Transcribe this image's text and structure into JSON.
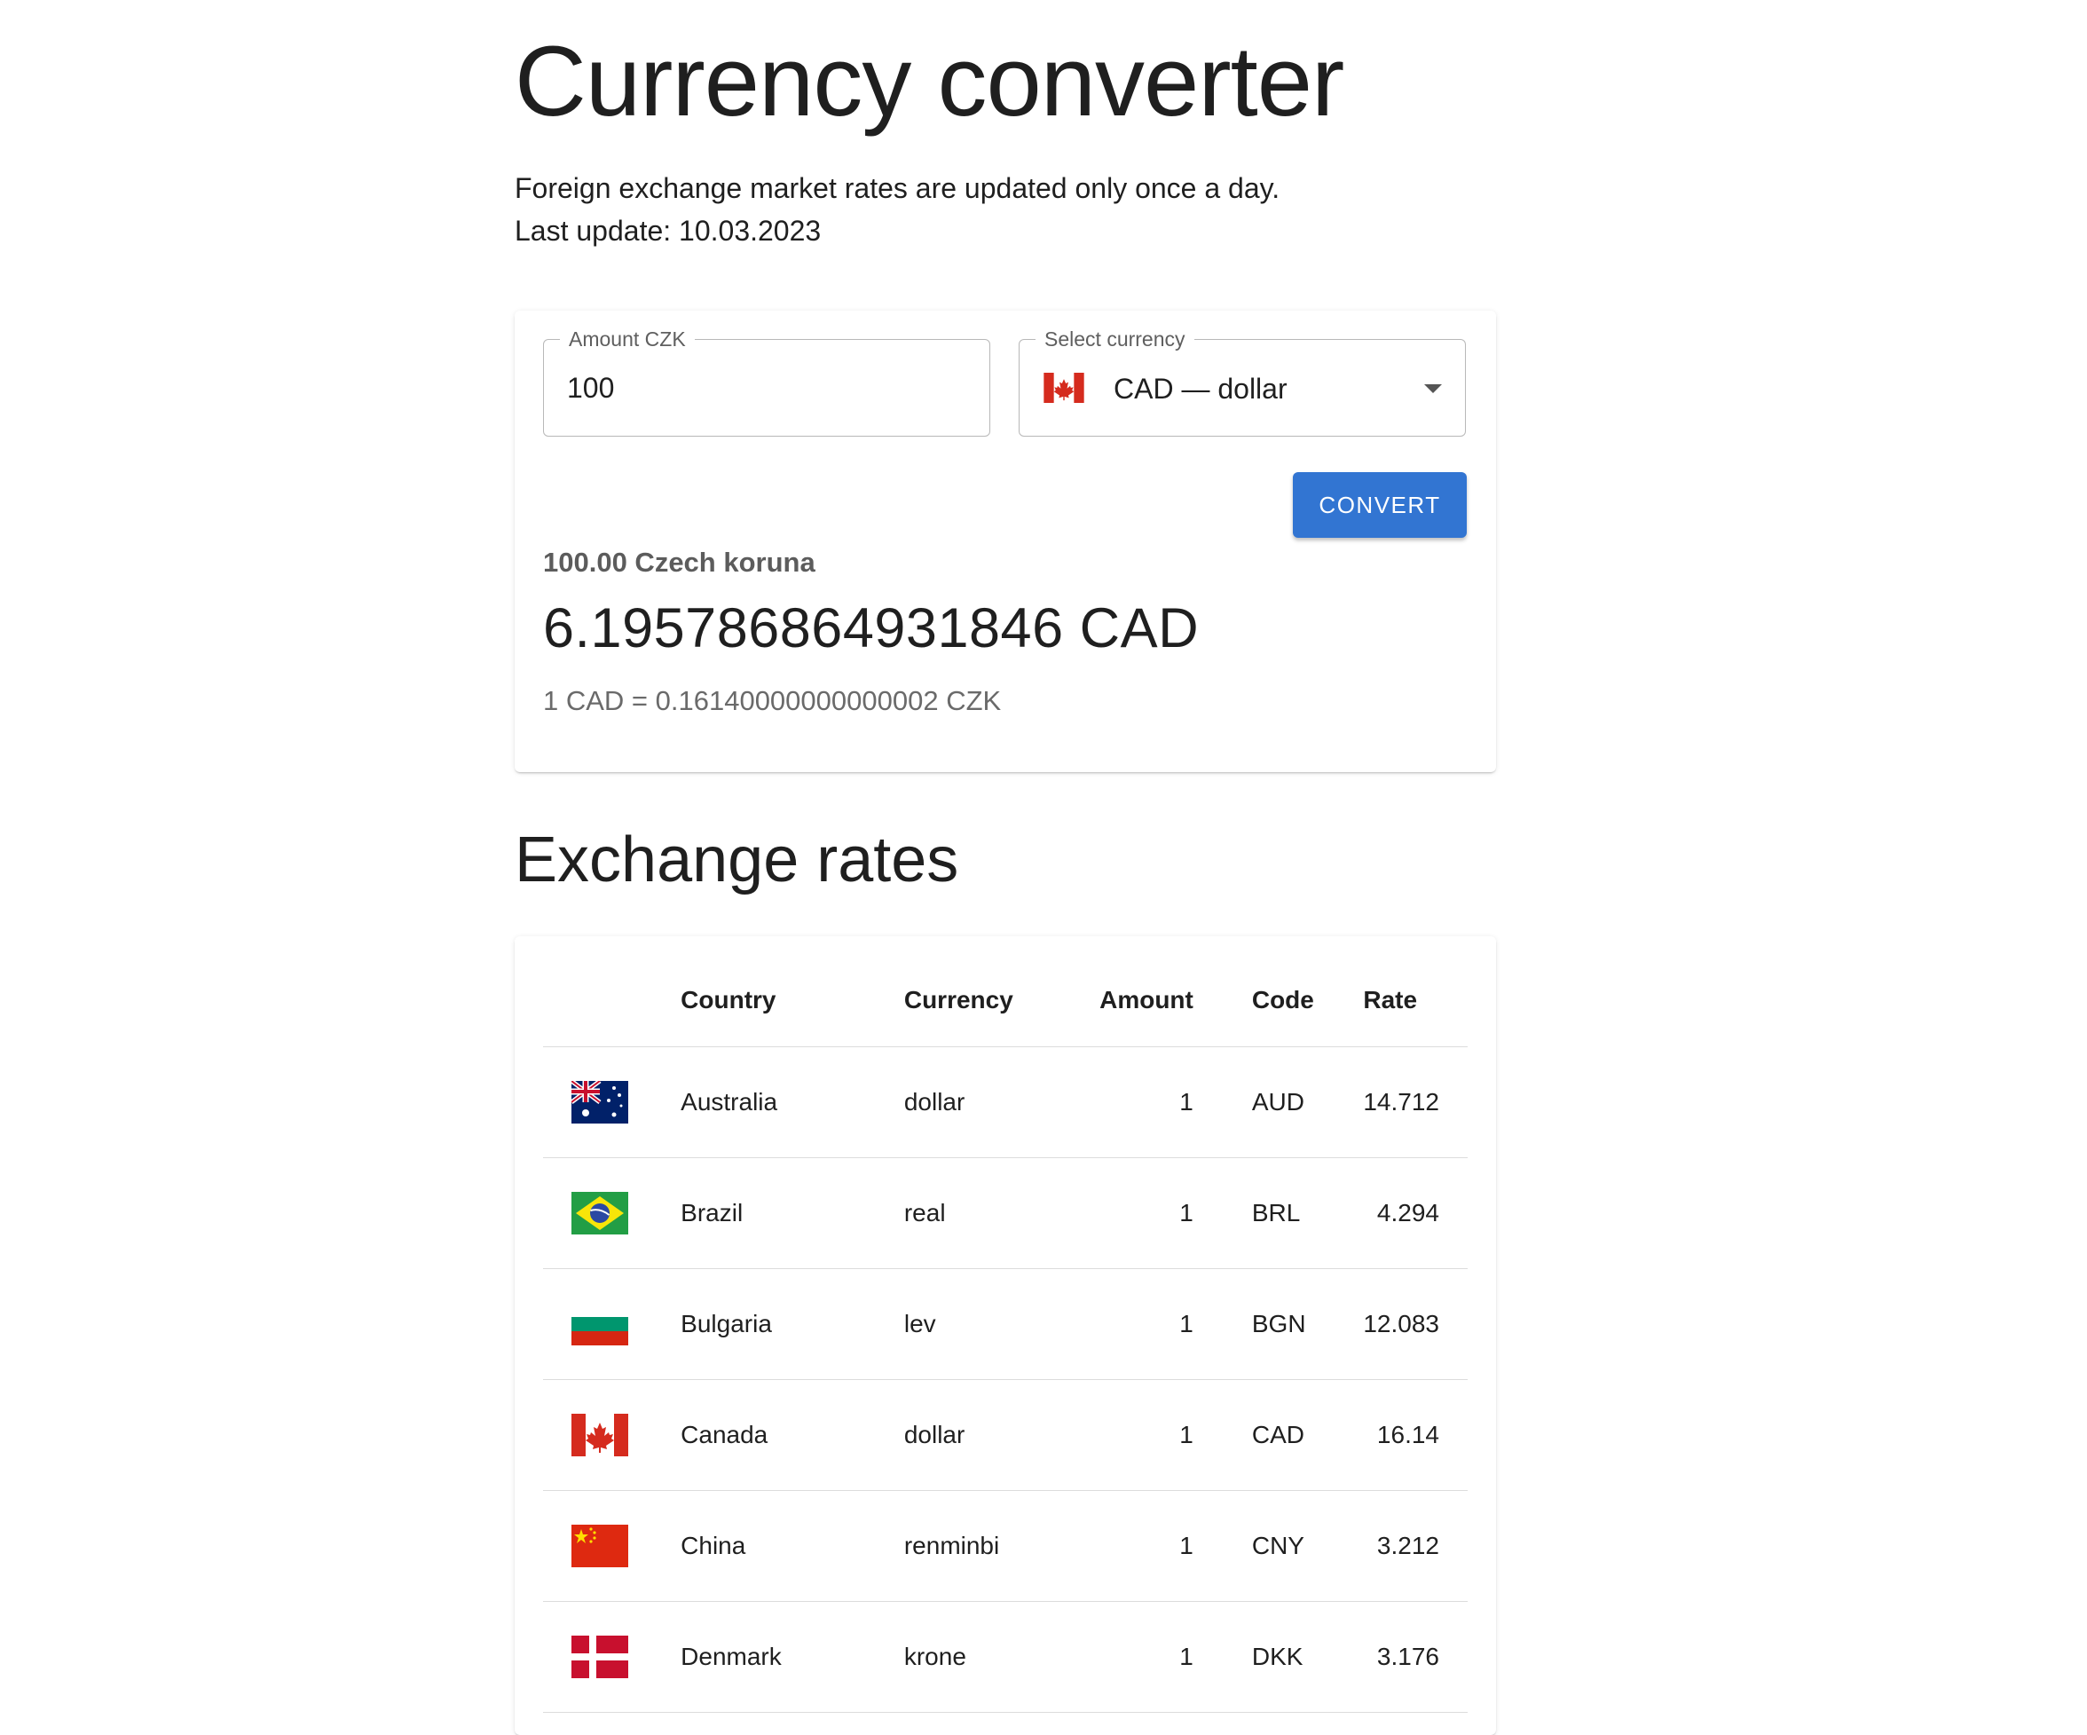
{
  "header": {
    "title": "Currency converter",
    "info_line1": "Foreign exchange market rates are updated only once a day.",
    "info_line2": "Last update: 10.03.2023"
  },
  "converter": {
    "amount_label": "Amount CZK",
    "amount_value": "100",
    "currency_label": "Select currency",
    "currency_value": "CAD — dollar",
    "selected_flag_icon": "canada-flag-icon",
    "convert_label": "CONVERT",
    "from_amount": "100.00 Czech koruna",
    "result": "6.195786864931846 CAD",
    "rate_line": "1 CAD = 0.16140000000000002 CZK"
  },
  "rates": {
    "section_title": "Exchange rates",
    "columns": [
      "",
      "Country",
      "Currency",
      "Amount",
      "Code",
      "Rate"
    ],
    "rows": [
      {
        "flag_icon": "australia-flag-icon",
        "country": "Australia",
        "currency": "dollar",
        "amount": "1",
        "code": "AUD",
        "rate": "14.712"
      },
      {
        "flag_icon": "brazil-flag-icon",
        "country": "Brazil",
        "currency": "real",
        "amount": "1",
        "code": "BRL",
        "rate": "4.294"
      },
      {
        "flag_icon": "bulgaria-flag-icon",
        "country": "Bulgaria",
        "currency": "lev",
        "amount": "1",
        "code": "BGN",
        "rate": "12.083"
      },
      {
        "flag_icon": "canada-flag-icon",
        "country": "Canada",
        "currency": "dollar",
        "amount": "1",
        "code": "CAD",
        "rate": "16.14"
      },
      {
        "flag_icon": "china-flag-icon",
        "country": "China",
        "currency": "renminbi",
        "amount": "1",
        "code": "CNY",
        "rate": "3.212"
      },
      {
        "flag_icon": "denmark-flag-icon",
        "country": "Denmark",
        "currency": "krone",
        "amount": "1",
        "code": "DKK",
        "rate": "3.176"
      }
    ]
  },
  "colors": {
    "accent": "#3275d2",
    "text": "#1f1f1f",
    "muted": "#6a6a6a"
  }
}
